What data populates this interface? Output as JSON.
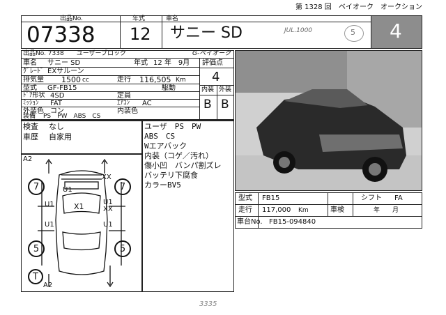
{
  "header": {
    "session": "第 1328 回",
    "auction": "ベイオーク　オークション",
    "col_lot": "出品No.",
    "col_year": "年式",
    "col_name": "車名",
    "lot_no": "07338",
    "year": "12",
    "car_name": "サニー SD",
    "grade_big": "4",
    "handwritten_price": "JUL.1000",
    "stamp": "5"
  },
  "info": {
    "lot_line": "出品No. 7338　　ユーザーブロック",
    "brand": "G-ベイオーク",
    "car_name_label": "車名",
    "car_name": "サニー SD",
    "nenshiki_label": "年式",
    "nenshiki": "12 年　9月",
    "grade_label": "ｸﾞﾚｰﾄﾞ",
    "grade": "EXサルーン",
    "displacement_label": "排気量",
    "displacement": "1500",
    "displacement_unit": "cc",
    "mileage_label": "走行",
    "mileage": "116,505",
    "mileage_unit": "Km",
    "drive_label": "駆動",
    "type_label": "型式",
    "type": "GF-FB15",
    "capacity_label": "定員",
    "door_label": "ﾄﾞｱ形状",
    "door": "4SD",
    "mission_label": "ﾐｯｼｮﾝ",
    "mission": "FAT",
    "aircon_label": "ｴｱｺﾝ",
    "aircon": "AC",
    "ext_color_label": "外装色",
    "ext_color": "コン",
    "int_color_label": "内装色",
    "equipment_label": "装備",
    "equipment": "PS　PW　ABS　CS",
    "shaken_label": "検査",
    "shaken": "なし",
    "history_label": "車歴",
    "history": "自家用"
  },
  "score": {
    "label": "評価点",
    "value": "4",
    "int_label": "内装",
    "ext_label": "外装",
    "int_value": "B",
    "ext_value": "B"
  },
  "notes": [
    "ユーザ　PS　PW",
    "ABS　CS",
    "Wエアバック",
    "内装（コゲ／汚れ）",
    "傷小凹　バンパ割ズレ",
    "バッテリ下腐食",
    "カラーBV5"
  ],
  "diagram": {
    "marks": {
      "a2_top": "A2",
      "xx_top": "XX",
      "u1_front": "U1",
      "x1_hood": "X1",
      "u1_left": "U1",
      "u1_right": "U1",
      "xx_right": "XX",
      "u1_mid_left": "U1",
      "u1_mid_right": "U1",
      "tire_fl": "7",
      "tire_fr": "7",
      "tire_rl": "5",
      "tire_rr": "5",
      "spare": "T",
      "a2_bottom": "A2"
    }
  },
  "spec": {
    "model_label": "型式",
    "model": "FB15",
    "shift_label": "シフト",
    "shift": "FA",
    "mileage_label": "走行",
    "mileage": "117,000",
    "mileage_unit": "Km",
    "inspection_label": "車検",
    "inspection_unit": "年　　月",
    "vin_label": "車台No.",
    "vin": "FB15-094840"
  },
  "footer_hand": "3335"
}
